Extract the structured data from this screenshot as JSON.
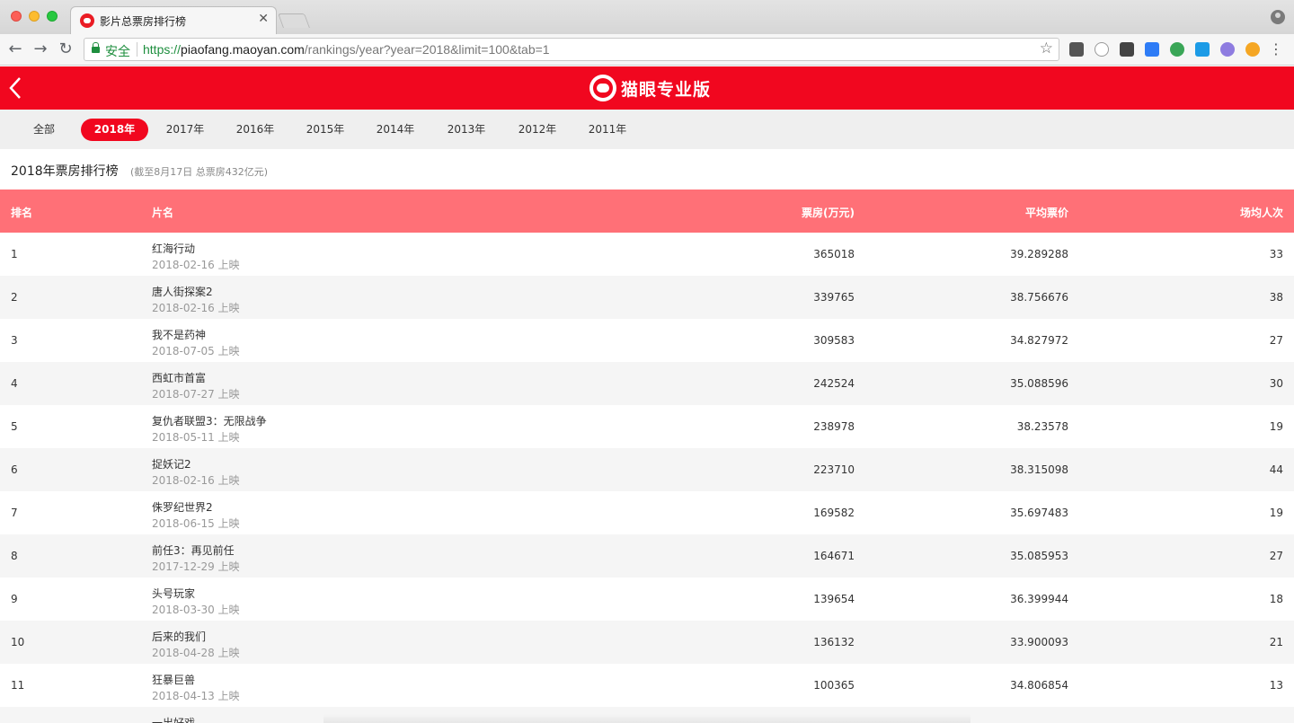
{
  "browser": {
    "tab_title": "影片总票房排行榜",
    "tab_close": "✕",
    "secure_label": "安全",
    "url_scheme": "https://",
    "url_host": "piaofang.maoyan.com",
    "url_path": "/rankings/year?year=2018&limit=100&tab=1",
    "back_glyph": "←",
    "forward_glyph": "→",
    "reload_glyph": "↻",
    "star_glyph": "☆",
    "menu_glyph": "⋮"
  },
  "header": {
    "brand": "猫眼专业版",
    "brand_color": "#f1071f"
  },
  "year_tabs": [
    {
      "label": "全部",
      "active": false
    },
    {
      "label": "2018年",
      "active": true
    },
    {
      "label": "2017年",
      "active": false
    },
    {
      "label": "2016年",
      "active": false
    },
    {
      "label": "2015年",
      "active": false
    },
    {
      "label": "2014年",
      "active": false
    },
    {
      "label": "2013年",
      "active": false
    },
    {
      "label": "2012年",
      "active": false
    },
    {
      "label": "2011年",
      "active": false
    }
  ],
  "ranking": {
    "title": "2018年票房排行榜",
    "subtitle": "(截至8月17日 总票房432亿元)"
  },
  "table": {
    "headers": {
      "rank": "排名",
      "name": "片名",
      "box": "票房(万元)",
      "price": "平均票价",
      "people": "场均人次"
    },
    "header_color": "#ff7077",
    "rows": [
      {
        "rank": "1",
        "name": "红海行动",
        "date": "2018-02-16 上映",
        "box": "365018",
        "price": "39.289288",
        "people": "33"
      },
      {
        "rank": "2",
        "name": "唐人街探案2",
        "date": "2018-02-16 上映",
        "box": "339765",
        "price": "38.756676",
        "people": "38"
      },
      {
        "rank": "3",
        "name": "我不是药神",
        "date": "2018-07-05 上映",
        "box": "309583",
        "price": "34.827972",
        "people": "27"
      },
      {
        "rank": "4",
        "name": "西虹市首富",
        "date": "2018-07-27 上映",
        "box": "242524",
        "price": "35.088596",
        "people": "30"
      },
      {
        "rank": "5",
        "name": "复仇者联盟3：无限战争",
        "date": "2018-05-11 上映",
        "box": "238978",
        "price": "38.23578",
        "people": "19"
      },
      {
        "rank": "6",
        "name": "捉妖记2",
        "date": "2018-02-16 上映",
        "box": "223710",
        "price": "38.315098",
        "people": "44"
      },
      {
        "rank": "7",
        "name": "侏罗纪世界2",
        "date": "2018-06-15 上映",
        "box": "169582",
        "price": "35.697483",
        "people": "19"
      },
      {
        "rank": "8",
        "name": "前任3：再见前任",
        "date": "2017-12-29 上映",
        "box": "164671",
        "price": "35.085953",
        "people": "27"
      },
      {
        "rank": "9",
        "name": "头号玩家",
        "date": "2018-03-30 上映",
        "box": "139654",
        "price": "36.399944",
        "people": "18"
      },
      {
        "rank": "10",
        "name": "后来的我们",
        "date": "2018-04-28 上映",
        "box": "136132",
        "price": "33.900093",
        "people": "21"
      },
      {
        "rank": "11",
        "name": "狂暴巨兽",
        "date": "2018-04-13 上映",
        "box": "100365",
        "price": "34.806854",
        "people": "13"
      },
      {
        "rank": "",
        "name": "一出好戏",
        "date": "",
        "box": "",
        "price": "",
        "people": ""
      }
    ]
  }
}
